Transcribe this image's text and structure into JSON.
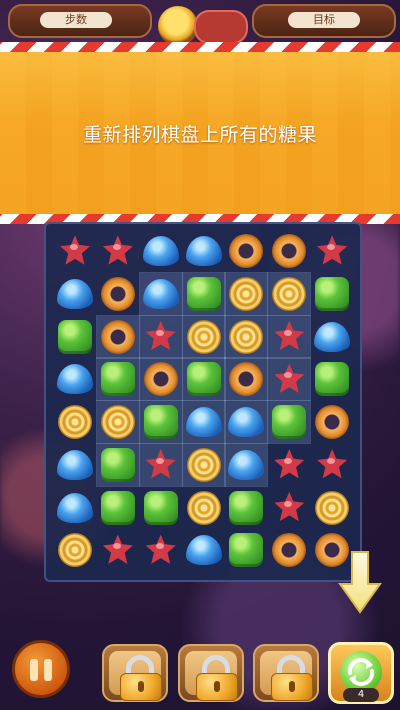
{
  "hud": {
    "steps_label": "步数",
    "target_label": "目标"
  },
  "banner": {
    "message": "重新排列棋盘上所有的糖果"
  },
  "board": {
    "rows": [
      [
        "star",
        "star",
        "drop",
        "drop",
        "donut",
        "donut",
        "star"
      ],
      [
        "drop",
        "donut",
        "drop",
        "square",
        "swirl",
        "swirl",
        "square"
      ],
      [
        "square",
        "donut",
        "star",
        "swirl",
        "swirl",
        "star",
        "drop"
      ],
      [
        "drop",
        "square",
        "donut",
        "square",
        "donut",
        "star",
        "square"
      ],
      [
        "swirl",
        "swirl",
        "square",
        "drop",
        "drop",
        "square",
        "donut"
      ],
      [
        "drop",
        "square",
        "star",
        "swirl",
        "drop",
        "star",
        "star"
      ],
      [
        "drop",
        "square",
        "square",
        "swirl",
        "square",
        "star",
        "swirl"
      ],
      [
        "swirl",
        "star",
        "star",
        "drop",
        "square",
        "donut",
        "donut"
      ]
    ],
    "highlighted": [
      [
        1,
        2
      ],
      [
        1,
        3
      ],
      [
        1,
        4
      ],
      [
        1,
        5
      ],
      [
        2,
        1
      ],
      [
        2,
        2
      ],
      [
        2,
        3
      ],
      [
        2,
        4
      ],
      [
        2,
        5
      ],
      [
        3,
        1
      ],
      [
        3,
        2
      ],
      [
        3,
        3
      ],
      [
        3,
        4
      ],
      [
        3,
        5
      ],
      [
        4,
        1
      ],
      [
        4,
        2
      ],
      [
        4,
        3
      ],
      [
        4,
        4
      ],
      [
        4,
        5
      ],
      [
        5,
        1
      ],
      [
        5,
        2
      ],
      [
        5,
        3
      ],
      [
        5,
        4
      ]
    ]
  },
  "boosters": {
    "locked_slots": 3,
    "shuffle_count": "4"
  },
  "icons": {
    "pause": "pause-icon",
    "lock": "lock-icon",
    "shuffle": "shuffle-icon",
    "arrow": "arrow-down-icon"
  }
}
